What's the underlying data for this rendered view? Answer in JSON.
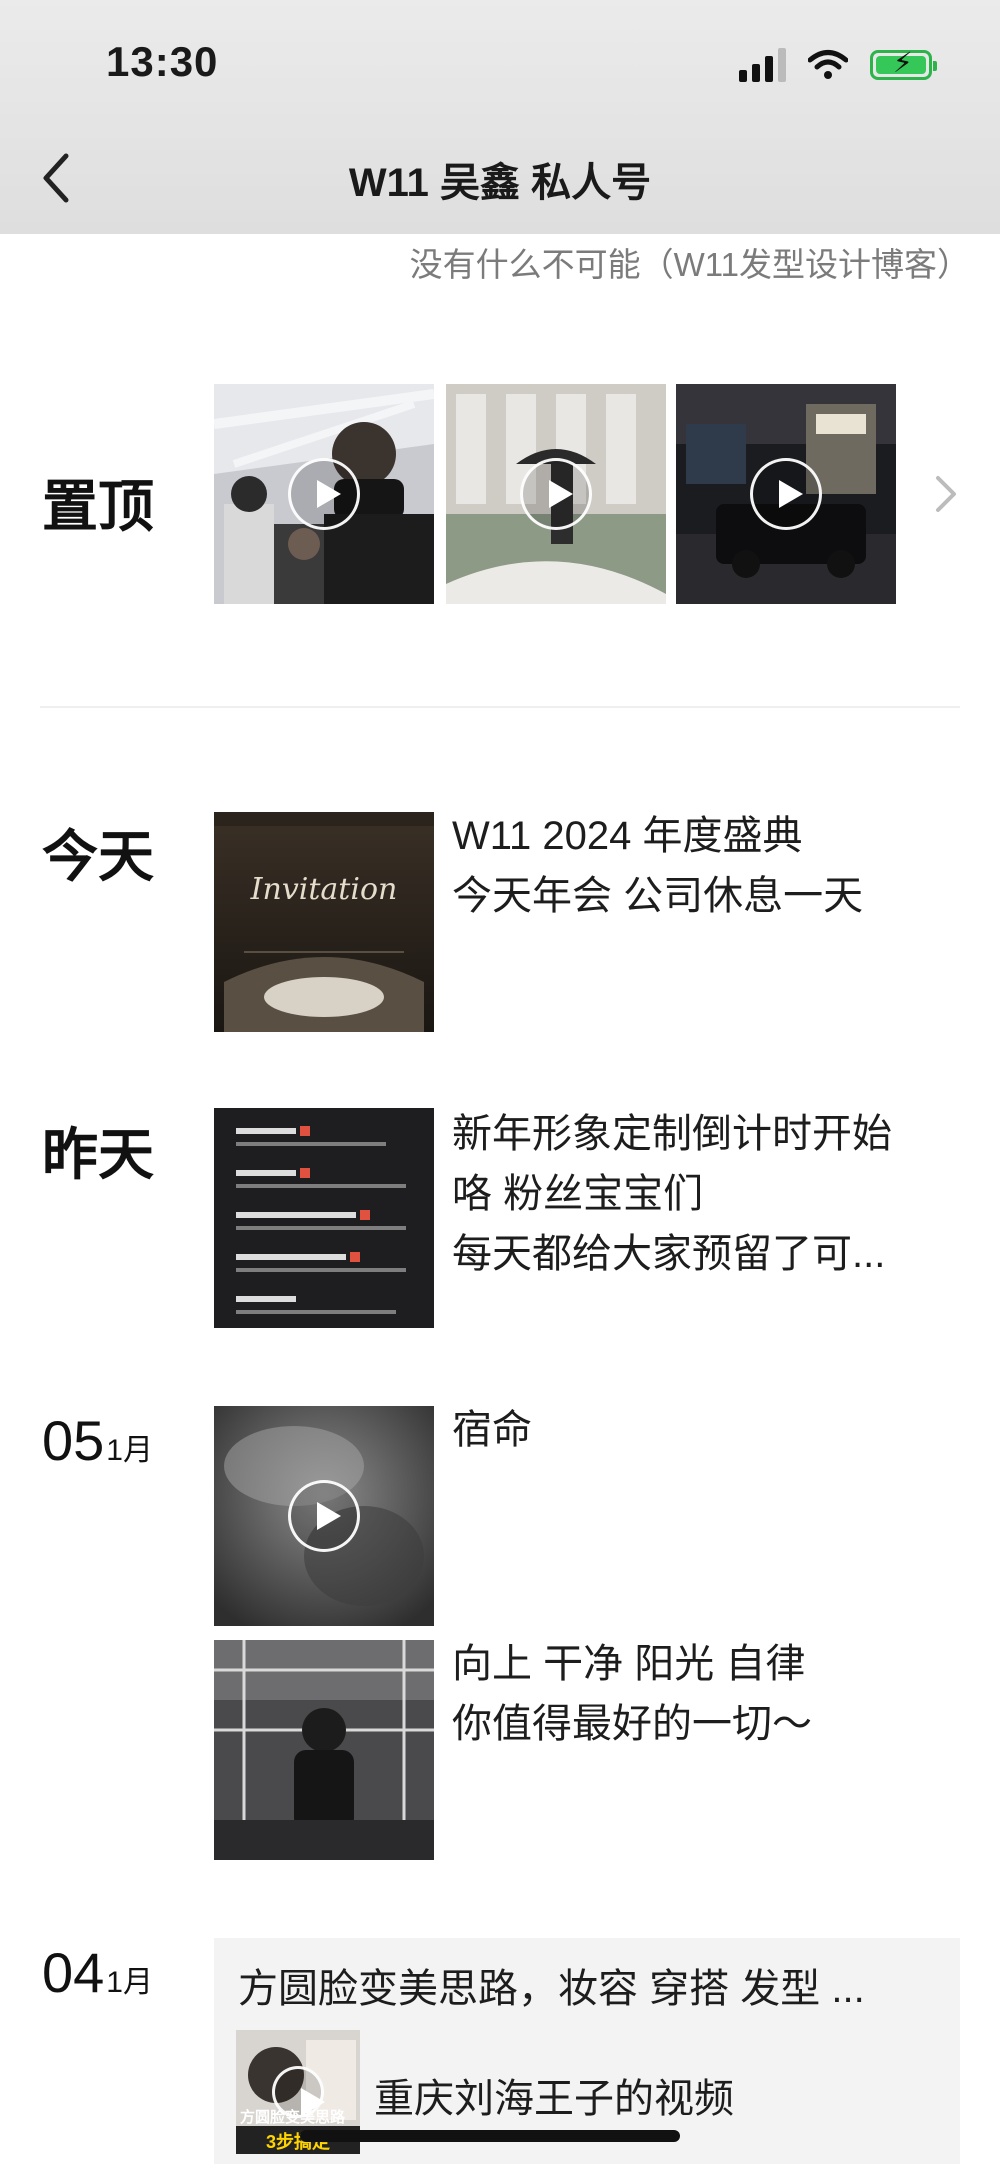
{
  "status_bar": {
    "time": "13:30"
  },
  "nav": {
    "title": "W11  吴鑫 私人号"
  },
  "profile": {
    "signature": "没有什么不可能（W11发型设计博客）"
  },
  "pinned": {
    "label": "置顶"
  },
  "posts": {
    "today": {
      "label": "今天",
      "text_line1": "W11    2024 年度盛典",
      "text_line2": "今天年会  公司休息一天",
      "thumb_caption": "Invitation"
    },
    "yesterday": {
      "label": "昨天",
      "text_line1": "新年形象定制倒计时开始",
      "text_line2": "咯  粉丝宝宝们",
      "text_line3": "每天都给大家预留了可..."
    },
    "jan05": {
      "day": "05",
      "month": "1月",
      "post1_text": "宿命",
      "post2_line1": "向上 干净  阳光  自律",
      "post2_line2": "你值得最好的一切～"
    },
    "jan04": {
      "day": "04",
      "month": "1月",
      "card_title": "方圆脸变美思路，妆容 穿搭 发型 ...",
      "card_sub": "重庆刘海王子的视频",
      "thumb_caption": "方圆脸变美思路",
      "thumb_badge": "3步搞定"
    }
  },
  "icons": {
    "back": "chevron-left-icon",
    "more": "chevron-right-icon",
    "play": "play-icon"
  },
  "colors": {
    "battery": "#35c758",
    "subtitle": "#7b7b7b",
    "card_bg": "#f3f3f3"
  }
}
